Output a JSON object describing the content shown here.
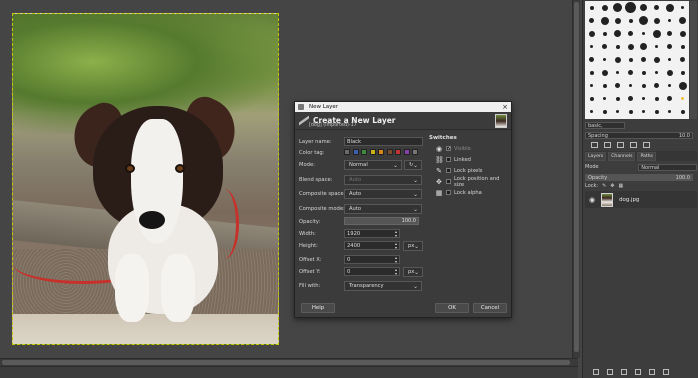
{
  "dialog": {
    "window_title": "New Layer",
    "header_title": "Create a New Layer",
    "header_subtitle": "[dog] (imported)-17",
    "fields": {
      "layer_name_label": "Layer name:",
      "layer_name_value": "Black",
      "color_tag_label": "Color tag:",
      "mode_label": "Mode:",
      "mode_value": "Normal",
      "blend_space_label": "Blend space:",
      "blend_space_value": "Auto",
      "composite_space_label": "Composite space:",
      "composite_space_value": "Auto",
      "composite_mode_label": "Composite mode:",
      "composite_mode_value": "Auto",
      "opacity_label": "Opacity:",
      "opacity_value": "100.0",
      "width_label": "Width:",
      "width_value": "1920",
      "height_label": "Height:",
      "height_value": "2400",
      "unit_value": "px",
      "offset_x_label": "Offset X:",
      "offset_x_value": "0",
      "offset_y_label": "Offset Y:",
      "offset_y_value": "0",
      "fill_label": "Fill with:",
      "fill_value": "Transparency"
    },
    "color_tags": [
      "#6a6a6a",
      "#3c5fb0",
      "#3e8a3e",
      "#c9b21b",
      "#d7861c",
      "#7a4b2a",
      "#c23333",
      "#8a3fa6",
      "#777777"
    ],
    "switches": {
      "title": "Switches",
      "visible": "Visible",
      "linked": "Linked",
      "lock_pixels": "Lock pixels",
      "lock_position": "Lock position and size",
      "lock_alpha": "Lock alpha"
    },
    "buttons": {
      "help": "Help",
      "ok": "OK",
      "cancel": "Cancel"
    }
  },
  "dock": {
    "brush_preset": "basic,",
    "spacing_label": "Spacing",
    "spacing_value": "10.0",
    "tabs": [
      "Layers",
      "Channels",
      "Paths"
    ],
    "mode_label": "Mode",
    "mode_value": "Normal",
    "opacity_label": "Opacity",
    "opacity_value": "100.0",
    "lock_label": "Lock:",
    "layer_name": "dog.jpg"
  }
}
